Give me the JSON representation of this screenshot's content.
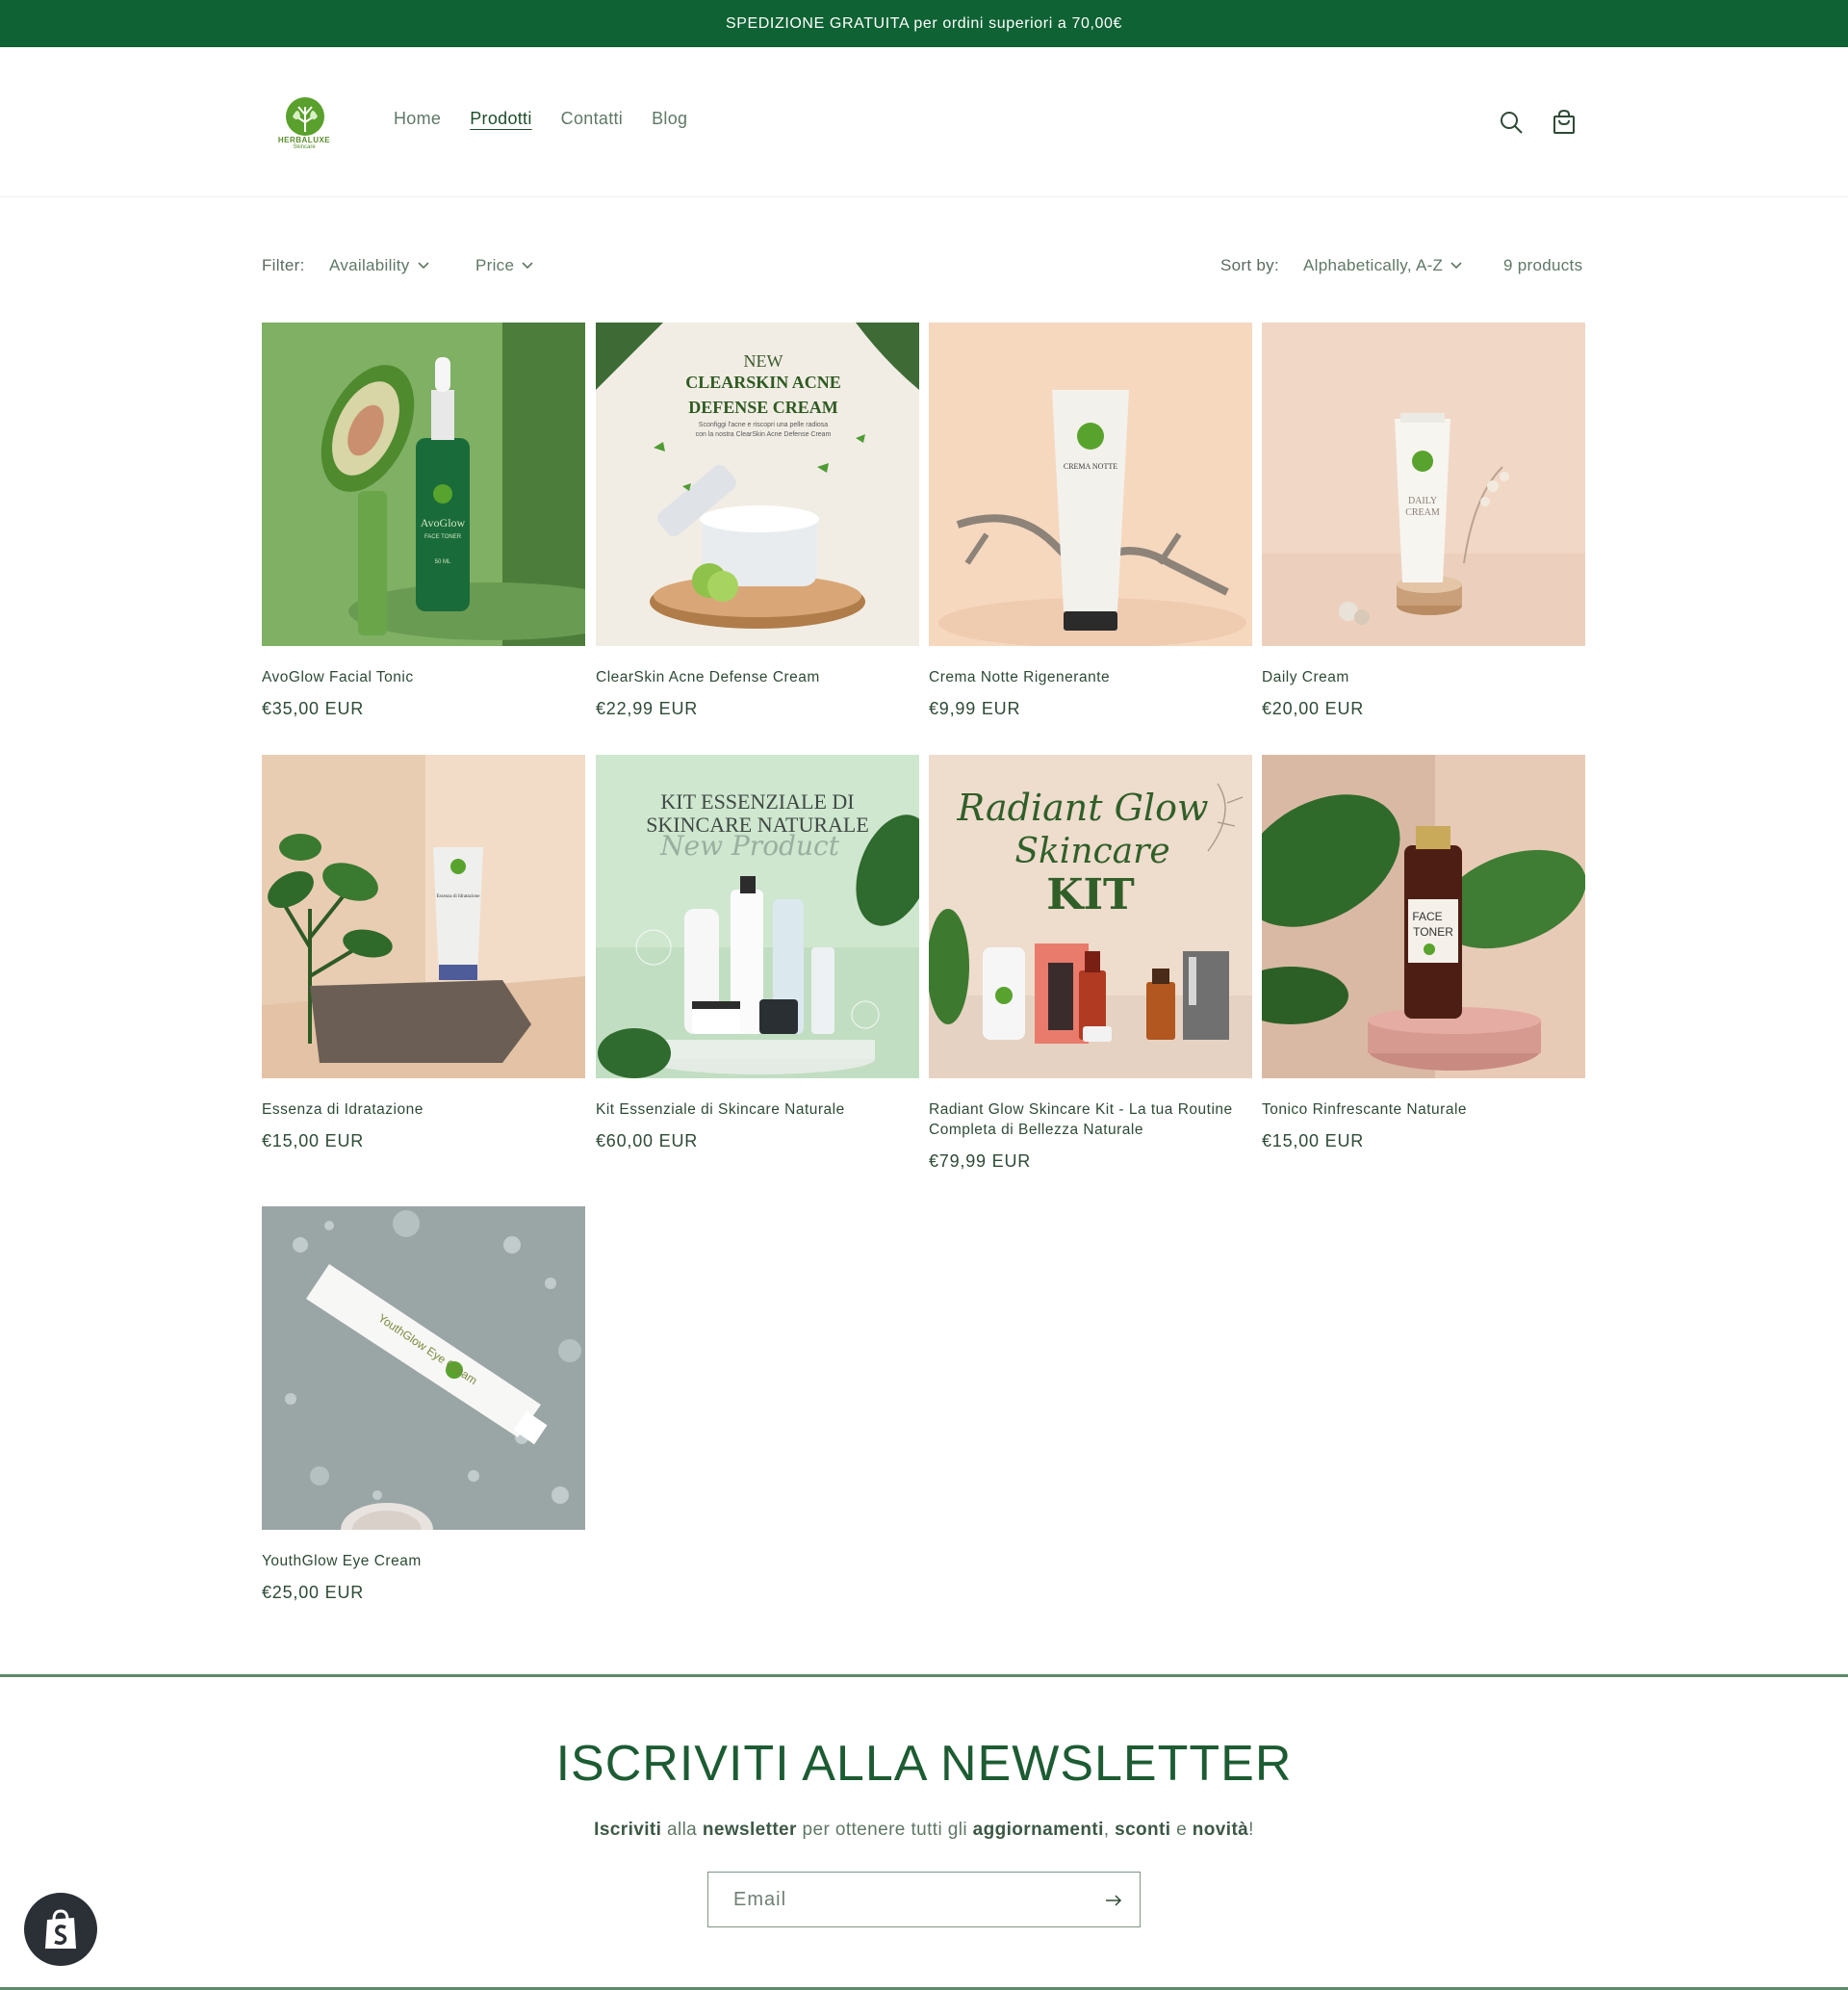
{
  "announcement": {
    "text": "SPEDIZIONE GRATUITA per ordini superiori a 70,00€"
  },
  "header": {
    "logo_text": "HERBALUXE",
    "logo_subtext": "Skincare",
    "nav": [
      {
        "label": "Home",
        "active": false
      },
      {
        "label": "Prodotti",
        "active": true
      },
      {
        "label": "Contatti",
        "active": false
      },
      {
        "label": "Blog",
        "active": false
      }
    ],
    "search_icon": "search-icon",
    "cart_icon": "cart-icon"
  },
  "facets": {
    "filter_label": "Filter:",
    "availability": "Availability",
    "price": "Price",
    "sort_label": "Sort by:",
    "sort_value": "Alphabetically, A-Z",
    "count": "9 products"
  },
  "products": [
    {
      "title": "AvoGlow Facial Tonic",
      "price": "€35,00 EUR"
    },
    {
      "title": "ClearSkin Acne Defense Cream",
      "price": "€22,99 EUR"
    },
    {
      "title": "Crema Notte Rigenerante",
      "price": "€9,99 EUR"
    },
    {
      "title": "Daily Cream",
      "price": "€20,00 EUR"
    },
    {
      "title": "Essenza di Idratazione",
      "price": "€15,00 EUR"
    },
    {
      "title": "Kit Essenziale di Skincare Naturale",
      "price": "€60,00 EUR"
    },
    {
      "title": "Radiant Glow Skincare Kit - La tua Routine Completa di Bellezza Naturale",
      "price": "€79,99 EUR"
    },
    {
      "title": "Tonico Rinfrescante Naturale",
      "price": "€15,00 EUR"
    },
    {
      "title": "YouthGlow Eye Cream",
      "price": "€25,00 EUR"
    }
  ],
  "image_text": {
    "p1_brand": "AvoGlow",
    "p1_sub": "FACE TONER",
    "p1_vol": "50 ML",
    "p2_l1": "NEW",
    "p2_l2": "CLEARSKIN ACNE",
    "p2_l3": "DEFENSE CREAM",
    "p2_l4": "Sconfiggi l'acne e riscopri una pelle radiosa",
    "p2_l5": "con la nostra ClearSkin Acne Defense Cream",
    "p3_label": "CREMA NOTTE",
    "p4_l1": "DAILY",
    "p4_l2": "CREAM",
    "p5_label": "Essenza di Idratazione",
    "p6_l1": "KIT ESSENZIALE DI",
    "p6_l2": "SKINCARE NATURALE",
    "p6_l3": "New Product",
    "p7_l1": "Radiant Glow",
    "p7_l2": "Skincare",
    "p7_l3": "KIT",
    "p8_l1": "FACE",
    "p8_l2": "TONER",
    "p9_label": "YouthGlow Eye Cream"
  },
  "newsletter": {
    "title": "ISCRIVITI ALLA NEWSLETTER",
    "sub_parts": [
      "Iscriviti",
      " alla ",
      "newsletter",
      " per ottenere tutti gli ",
      "aggiornamenti",
      ", ",
      "sconti",
      " e ",
      "novità",
      "!"
    ],
    "email_placeholder": "Email"
  },
  "colors": {
    "brand_green": "#0e6233",
    "text": "#2e4a36",
    "muted": "#5f7866"
  }
}
